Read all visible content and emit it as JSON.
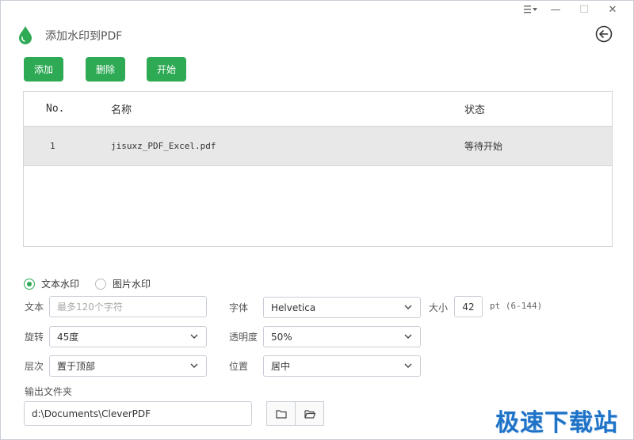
{
  "window": {
    "title": "添加水印到PDF",
    "minimize_glyph": "—",
    "maximize_glyph": "☐",
    "close_glyph": "✕"
  },
  "icons": {
    "logo": "water-drop-icon",
    "back": "back-arrow-icon",
    "menu": "menu-icon",
    "folder": "folder-icon",
    "folder_open": "folder-open-icon"
  },
  "colors": {
    "accent": "#2eaa55",
    "row_selected": "#e8e8e8",
    "watermark": "#1f73c7"
  },
  "toolbar": {
    "add": "添加",
    "delete": "删除",
    "start": "开始"
  },
  "table": {
    "headers": {
      "no": "No.",
      "name": "名称",
      "status": "状态"
    },
    "rows": [
      {
        "no": "1",
        "name": "jisuxz_PDF_Excel.pdf",
        "status": "等待开始"
      }
    ]
  },
  "mode": {
    "text": "文本水印",
    "image": "图片水印",
    "selected": "text"
  },
  "form": {
    "text_label": "文本",
    "text_placeholder": "最多120个字符",
    "font_label": "字体",
    "font_value": "Helvetica",
    "size_label": "大小",
    "size_value": "42",
    "size_unit": "pt (6-144)",
    "rotate_label": "旋转",
    "rotate_value": "45度",
    "opacity_label": "透明度",
    "opacity_value": "50%",
    "layer_label": "层次",
    "layer_value": "置于顶部",
    "position_label": "位置",
    "position_value": "居中",
    "output_label": "输出文件夹",
    "output_value": "d:\\Documents\\CleverPDF"
  },
  "watermark_text": "极速下载站"
}
